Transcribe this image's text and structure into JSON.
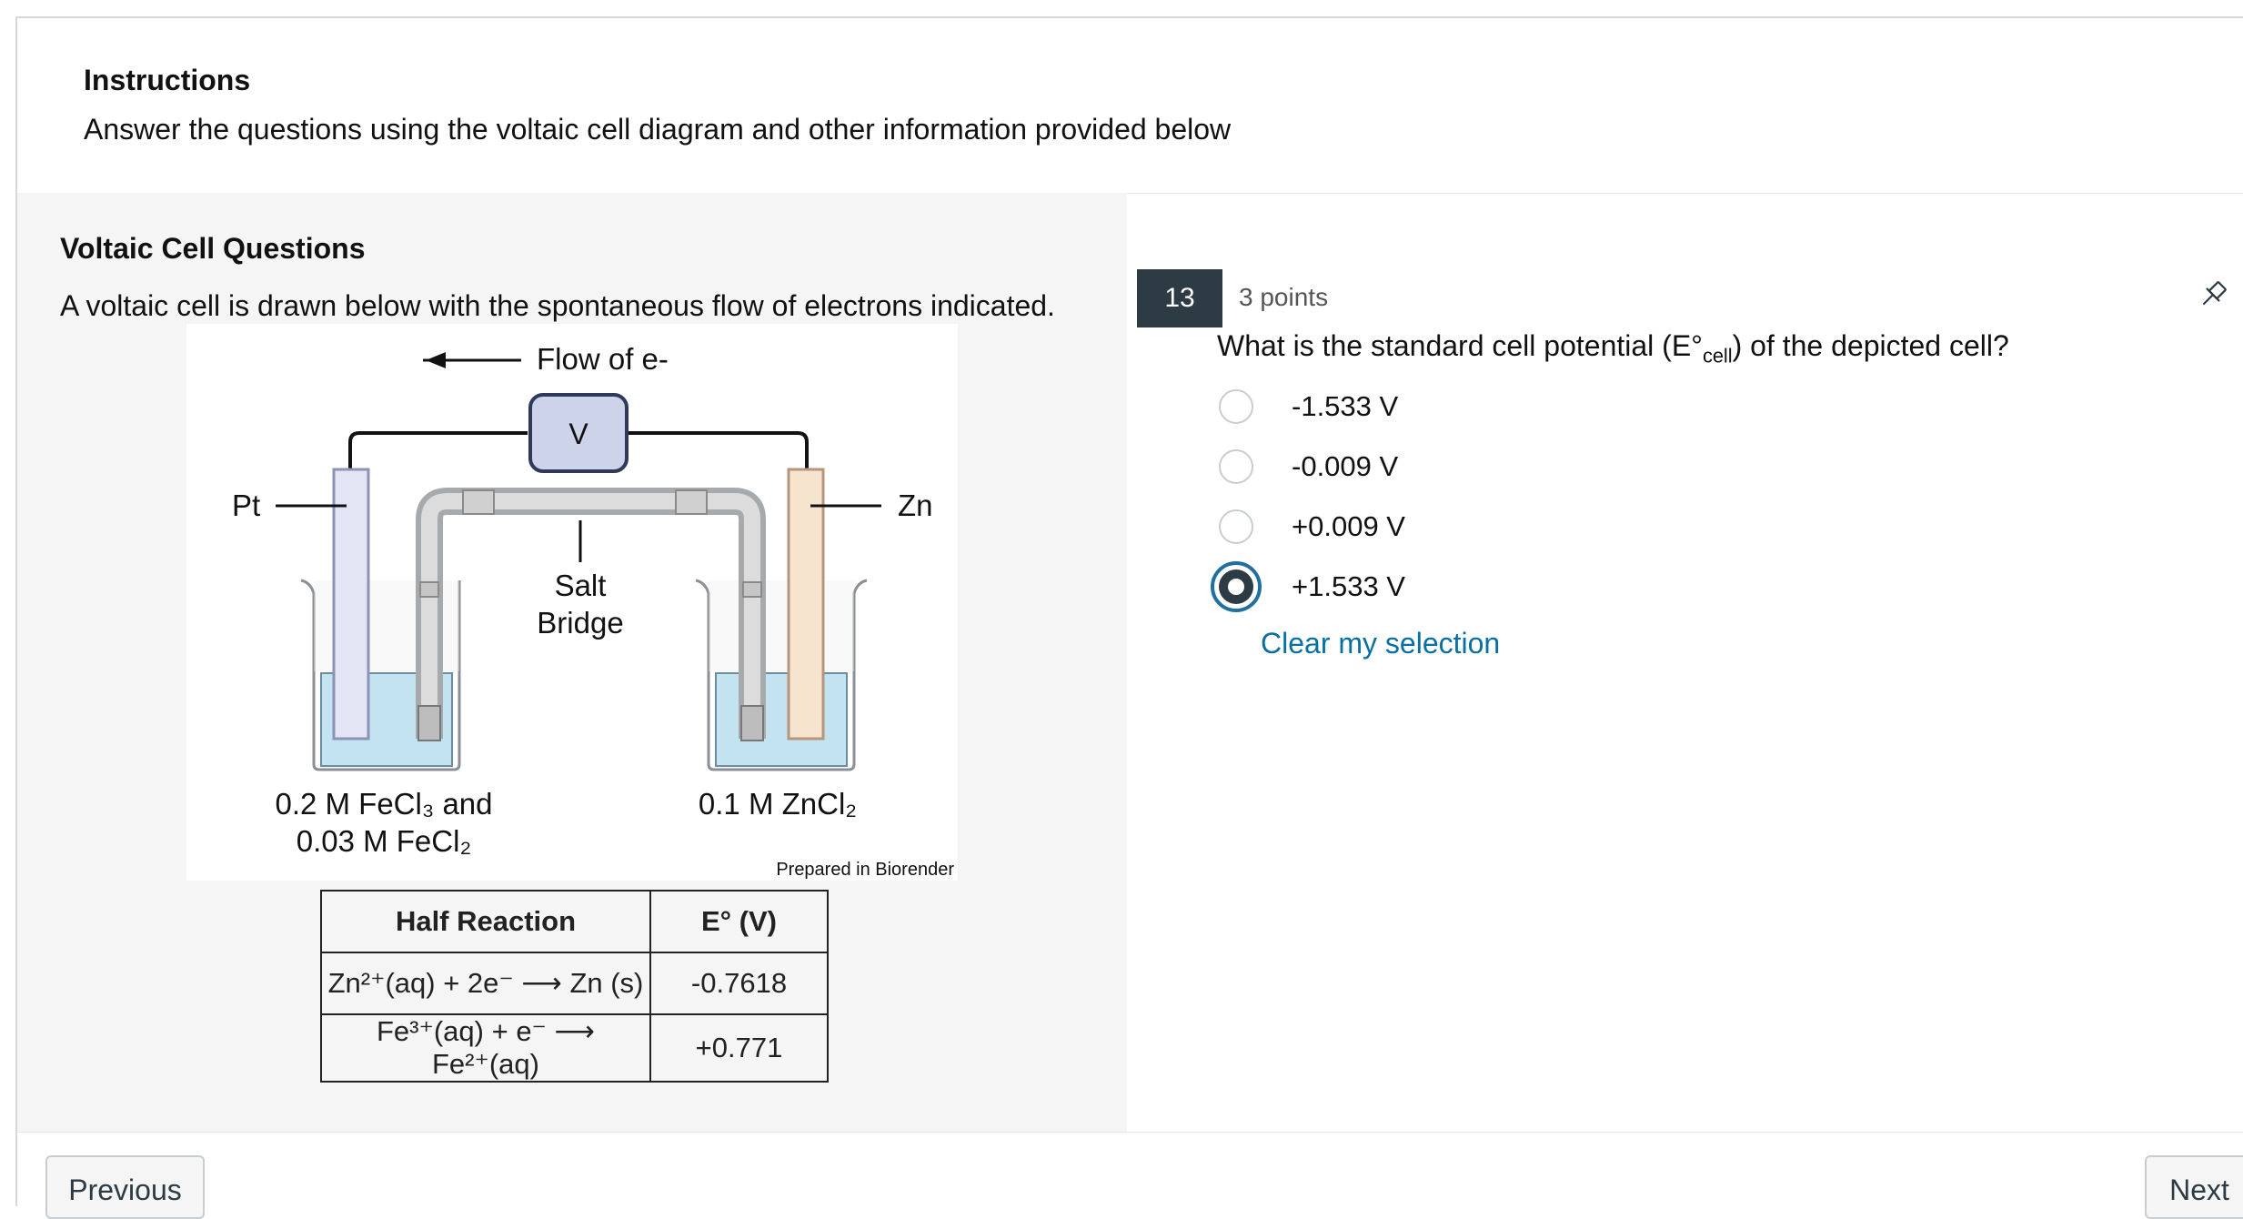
{
  "instructions": {
    "title": "Instructions",
    "text": "Answer the questions using the voltaic cell diagram and other information provided below"
  },
  "stimulus": {
    "title": "Voltaic Cell Questions",
    "text": "A voltaic cell is drawn below with the spontaneous flow of electrons indicated.",
    "diagram": {
      "flow_label": "Flow of e-",
      "voltmeter": "V",
      "left_electrode": "Pt",
      "right_electrode": "Zn",
      "salt_bridge_line1": "Salt",
      "salt_bridge_line2": "Bridge",
      "left_solution_line1": "0.2 M FeCl₃ and",
      "left_solution_line2": "0.03 M FeCl₂",
      "right_solution": "0.1 M ZnCl₂",
      "credit": "Prepared in Biorender"
    },
    "table": {
      "headers": [
        "Half Reaction",
        "E° (V)"
      ],
      "rows": [
        {
          "reaction": "Zn²⁺(aq) + 2e⁻ ⟶ Zn (s)",
          "potential": "-0.7618"
        },
        {
          "reaction": "Fe³⁺(aq) + e⁻ ⟶ Fe²⁺(aq)",
          "potential": "+0.771"
        }
      ]
    }
  },
  "question": {
    "number": "13",
    "points": "3 points",
    "text_before": "What is the standard cell potential (E°",
    "text_sub": "cell",
    "text_after": ") of the depicted cell?",
    "options": [
      {
        "label": "-1.533 V",
        "selected": false
      },
      {
        "label": "-0.009 V",
        "selected": false
      },
      {
        "label": "+0.009 V",
        "selected": false
      },
      {
        "label": "+1.533 V",
        "selected": true
      }
    ],
    "clear_label": "Clear my selection"
  },
  "nav": {
    "previous": "Previous",
    "next": "Next"
  },
  "colors": {
    "accent": "#0770a3",
    "question_badge": "#2d3b45"
  }
}
